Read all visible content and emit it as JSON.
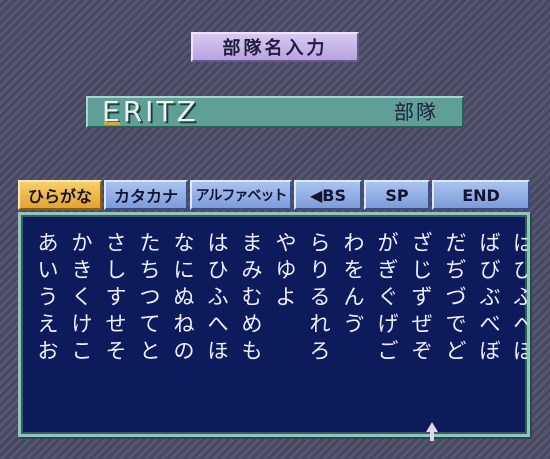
{
  "title": "部隊名入力",
  "name_field": {
    "value": "ERITZ",
    "suffix": "部隊"
  },
  "tabs": [
    {
      "label": "ひらがな",
      "active": true
    },
    {
      "label": "カタカナ",
      "active": false
    },
    {
      "label": "アルファベット",
      "active": false
    },
    {
      "label": "◀BS",
      "active": false
    },
    {
      "label": "SP",
      "active": false
    },
    {
      "label": "END",
      "active": false
    }
  ],
  "character_grid": [
    [
      "あ",
      "か",
      "さ",
      "た",
      "な",
      "は",
      "ま",
      "や",
      "ら",
      "わ",
      "が",
      "ざ",
      "だ",
      "ば",
      "ぱ"
    ],
    [
      "い",
      "き",
      "し",
      "ち",
      "に",
      "ひ",
      "み",
      "ゆ",
      "り",
      "を",
      "ぎ",
      "じ",
      "ぢ",
      "び",
      "ぴ"
    ],
    [
      "う",
      "く",
      "す",
      "つ",
      "ぬ",
      "ふ",
      "む",
      "よ",
      "る",
      "ん",
      "ぐ",
      "ず",
      "づ",
      "ぶ",
      "ぷ"
    ],
    [
      "え",
      "け",
      "せ",
      "て",
      "ね",
      "へ",
      "め",
      "",
      "れ",
      "ゔ",
      "げ",
      "ぜ",
      "で",
      "べ",
      "ぺ"
    ],
    [
      "お",
      "こ",
      "そ",
      "と",
      "の",
      "ほ",
      "も",
      "",
      "ろ",
      "",
      "ご",
      "ぞ",
      "ど",
      "ぼ",
      "ぽ"
    ]
  ],
  "colors": {
    "active_tab": "#e2a332",
    "inactive_tab": "#7d9bd8",
    "grid_background": "#0d1a5b",
    "name_field": "#5f9f97",
    "title_box": "#b8a3e0"
  }
}
